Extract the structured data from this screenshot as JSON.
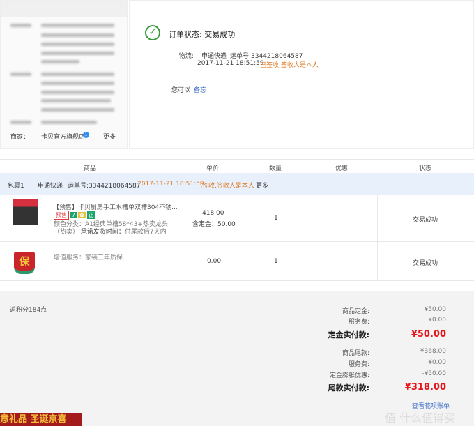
{
  "sidebar": {
    "merchant_label": "商家：",
    "merchant_name": "卡贝官方旗舰店",
    "merchant_badge": "1",
    "more": "更多"
  },
  "status": {
    "title": "订单状态: 交易成功",
    "logistics_label": "· 物流:",
    "carrier": "申通快递",
    "waybill": "运单号:3344218064587",
    "time": "2017-11-21 18:51:59",
    "sign_status": "已签收,签收人是本人",
    "you_can": "您可以",
    "memo_link": "备忘"
  },
  "table": {
    "headers": [
      "商品",
      "单价",
      "数量",
      "优惠",
      "状态"
    ],
    "package": {
      "label": "包裹1",
      "carrier": "申通快递",
      "waybill": "运单号:3344218064587",
      "time": "2017-11-21 18:51:59",
      "sign_status": "已签收,签收人是本人",
      "more": "更多"
    },
    "items": [
      {
        "title": "【预售】卡贝厨房手工水槽单双槽304不锈...",
        "tags": [
          "预售",
          "7",
          "✿",
          "正"
        ],
        "spec_label": "颜色分类：",
        "spec": "A1经典单槽58*43+热卖龙头（热卖）",
        "ship_label": "承诺发货时间：",
        "ship": "付尾款后7天内",
        "price": "418.00",
        "deposit": "含定金：50.00",
        "qty": "1",
        "status": "交易成功"
      },
      {
        "title": "增值服务：家装三年质保",
        "icon_text": "保",
        "price": "0.00",
        "qty": "1",
        "status": "交易成功"
      }
    ]
  },
  "summary": {
    "points": "返积分184点",
    "rows": [
      {
        "label": "商品定金:",
        "value": "¥50.00"
      },
      {
        "label": "服务费:",
        "value": "¥0.00"
      },
      {
        "label": "定金实付款:",
        "value": "¥50.00",
        "big": true
      },
      {
        "label": "商品尾款:",
        "value": "¥368.00"
      },
      {
        "label": "服务费:",
        "value": "¥0.00"
      },
      {
        "label": "定金膨胀优惠:",
        "value": "-¥50.00"
      },
      {
        "label": "尾款实付款:",
        "value": "¥318.00",
        "big": true
      }
    ],
    "link": "查看花呗账单"
  },
  "banner": "意礼品 圣诞京喜",
  "watermark": "值 什么值得买"
}
